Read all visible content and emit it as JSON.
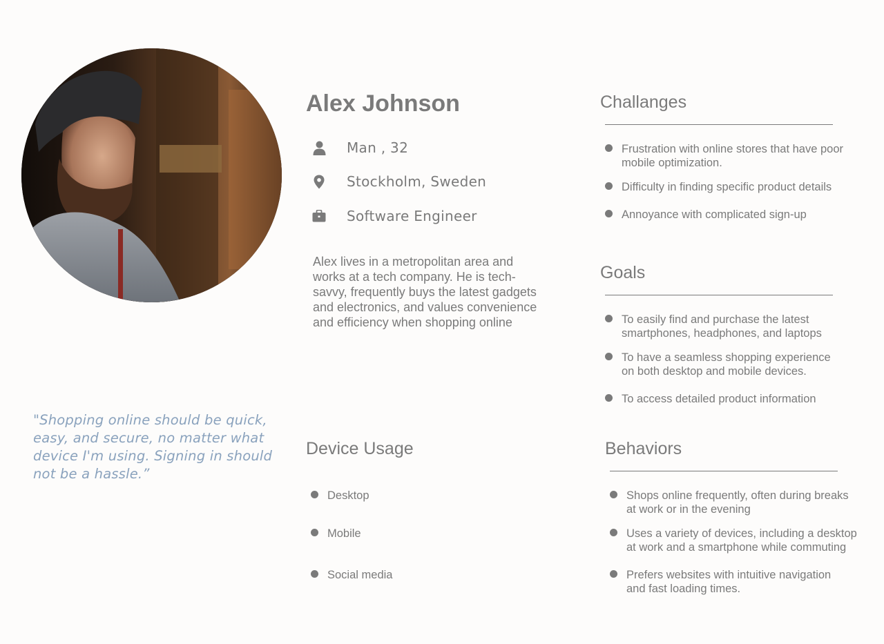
{
  "persona": {
    "name": "Alex Johnson",
    "gender_age": "Man ,  32",
    "location": "Stockholm, Sweden",
    "occupation": "Software Engineer",
    "bio": "Alex lives in a metropolitan area and works at a tech company. He is tech-savvy, frequently buys the latest gadgets and electronics, and values convenience and efficiency when shopping online",
    "quote": "\"Shopping online should be quick, easy, and secure, no matter what device I'm using. Signing in should not be a hassle.”"
  },
  "icons": {
    "gender_age": "person-icon",
    "location": "map-pin-icon",
    "occupation": "briefcase-icon"
  },
  "challenges": {
    "title": "Challanges",
    "items": [
      "Frustration with online stores that have poor\nmobile optimization.",
      "Difficulty in finding specific product details",
      "Annoyance with complicated sign-up"
    ]
  },
  "goals": {
    "title": "Goals",
    "items": [
      "To easily find and purchase the latest\nsmartphones, headphones, and laptops",
      "To have a seamless shopping experience\non both desktop and mobile devices.",
      "To access detailed product information"
    ]
  },
  "device_usage": {
    "title": "Device Usage",
    "items": [
      "Desktop",
      "Mobile",
      "Social media"
    ]
  },
  "behaviors": {
    "title": "Behaviors",
    "items": [
      "Shops online frequently, often during breaks\nat work or in the evening",
      "Uses a variety of devices, including a desktop\n at work and a smartphone while commuting",
      "Prefers websites with intuitive navigation\nand fast loading times."
    ]
  },
  "colors": {
    "text": "#7a7a7a",
    "quote": "#8aa2bd",
    "background": "#fdfcfb"
  }
}
